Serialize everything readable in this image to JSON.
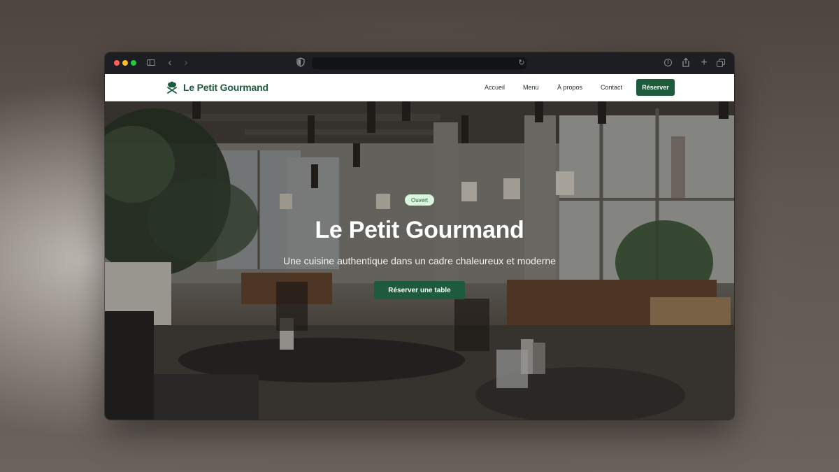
{
  "browser": {
    "address": "",
    "icons": [
      "sidebar-icon",
      "back-icon",
      "forward-icon",
      "shield-icon",
      "reload-icon",
      "download-icon",
      "share-icon",
      "new-tab-icon",
      "tab-overview-icon"
    ]
  },
  "site": {
    "brand": "Le Petit Gourmand",
    "brand_icon": "chef-hat-utensils-icon",
    "nav": {
      "accueil": "Accueil",
      "menu": "Menu",
      "apropos": "À propos",
      "contact": "Contact",
      "reserve_button": "Réserver"
    },
    "hero": {
      "badge": "Ouvert",
      "title": "Le Petit Gourmand",
      "subtitle": "Une cuisine authentique dans un cadre chaleureux et moderne",
      "cta": "Réserver une table"
    }
  },
  "colors": {
    "brand_green": "#1e5a3c",
    "badge_bg": "#d9f6dd"
  }
}
